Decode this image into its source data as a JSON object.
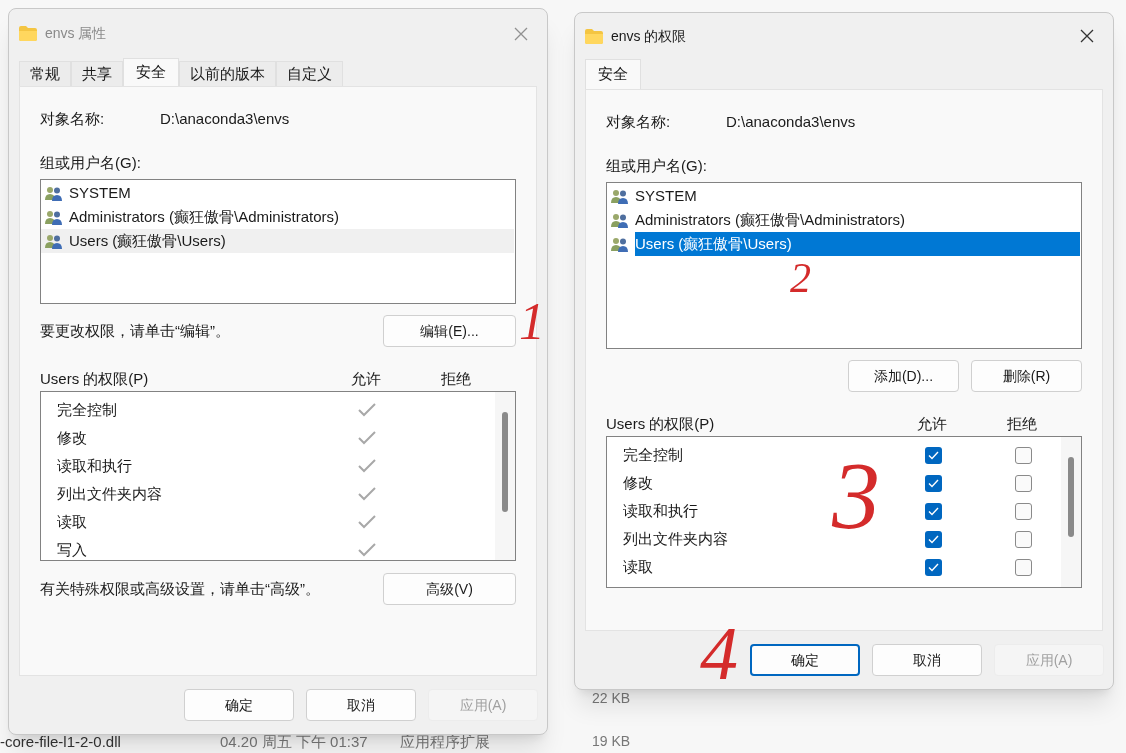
{
  "background_files": [
    {
      "name": "-core-file-l1-2-0.dll",
      "date": "04.20 周五 下午 01:37",
      "type": "应用程序扩展"
    }
  ],
  "background_sizes": [
    "22 KB",
    "19 KB"
  ],
  "dialogs": [
    {
      "title": "envs 属性",
      "active": false,
      "tabs": [
        {
          "label": "常规",
          "selected": false
        },
        {
          "label": "共享",
          "selected": false
        },
        {
          "label": "安全",
          "selected": true
        },
        {
          "label": "以前的版本",
          "selected": false
        },
        {
          "label": "自定义",
          "selected": false
        }
      ],
      "object_label": "对象名称:",
      "object_value": "D:\\anaconda3\\envs",
      "group_label": "组或用户名(G):",
      "users": [
        {
          "name": "SYSTEM",
          "selected": false
        },
        {
          "name": "Administrators (癫狂傲骨\\Administrators)",
          "selected": false
        },
        {
          "name": "Users (癫狂傲骨\\Users)",
          "selected": true
        }
      ],
      "list_hint": "要更改权限，请单击“编辑”。",
      "list_buttons": [
        "编辑(E)..."
      ],
      "permissions_label": "Users 的权限(P)",
      "allow_header": "允许",
      "deny_header": "拒绝",
      "kind": "readonly",
      "permissions": [
        {
          "name": "完全控制",
          "allow": true,
          "deny": false
        },
        {
          "name": "修改",
          "allow": true,
          "deny": false
        },
        {
          "name": "读取和执行",
          "allow": true,
          "deny": false
        },
        {
          "name": "列出文件夹内容",
          "allow": true,
          "deny": false
        },
        {
          "name": "读取",
          "allow": true,
          "deny": false
        },
        {
          "name": "写入",
          "allow": true,
          "deny": false
        }
      ],
      "advanced_hint": "有关特殊权限或高级设置，请单击“高级”。",
      "advanced_button": "高级(V)",
      "footer_buttons": [
        {
          "label": "确定",
          "disabled": false,
          "focused": false
        },
        {
          "label": "取消",
          "disabled": false,
          "focused": false
        },
        {
          "label": "应用(A)",
          "disabled": true,
          "focused": false
        }
      ]
    },
    {
      "title": "envs 的权限",
      "active": true,
      "tabs": [
        {
          "label": "安全",
          "selected": true
        }
      ],
      "object_label": "对象名称:",
      "object_value": "D:\\anaconda3\\envs",
      "group_label": "组或用户名(G):",
      "users": [
        {
          "name": "SYSTEM",
          "selected": false
        },
        {
          "name": "Administrators (癫狂傲骨\\Administrators)",
          "selected": false
        },
        {
          "name": "Users (癫狂傲骨\\Users)",
          "selected": true
        }
      ],
      "list_buttons": [
        "添加(D)...",
        "删除(R)"
      ],
      "permissions_label": "Users 的权限(P)",
      "allow_header": "允许",
      "deny_header": "拒绝",
      "kind": "checkbox",
      "permissions": [
        {
          "name": "完全控制",
          "allow": true,
          "deny": false
        },
        {
          "name": "修改",
          "allow": true,
          "deny": false
        },
        {
          "name": "读取和执行",
          "allow": true,
          "deny": false
        },
        {
          "name": "列出文件夹内容",
          "allow": true,
          "deny": false
        },
        {
          "name": "读取",
          "allow": true,
          "deny": false
        }
      ],
      "footer_buttons": [
        {
          "label": "确定",
          "disabled": false,
          "focused": true
        },
        {
          "label": "取消",
          "disabled": false,
          "focused": false
        },
        {
          "label": "应用(A)",
          "disabled": true,
          "focused": false
        }
      ]
    }
  ],
  "annotations": [
    {
      "text": "1"
    },
    {
      "text": "2"
    },
    {
      "text": "3"
    },
    {
      "text": "4"
    }
  ]
}
